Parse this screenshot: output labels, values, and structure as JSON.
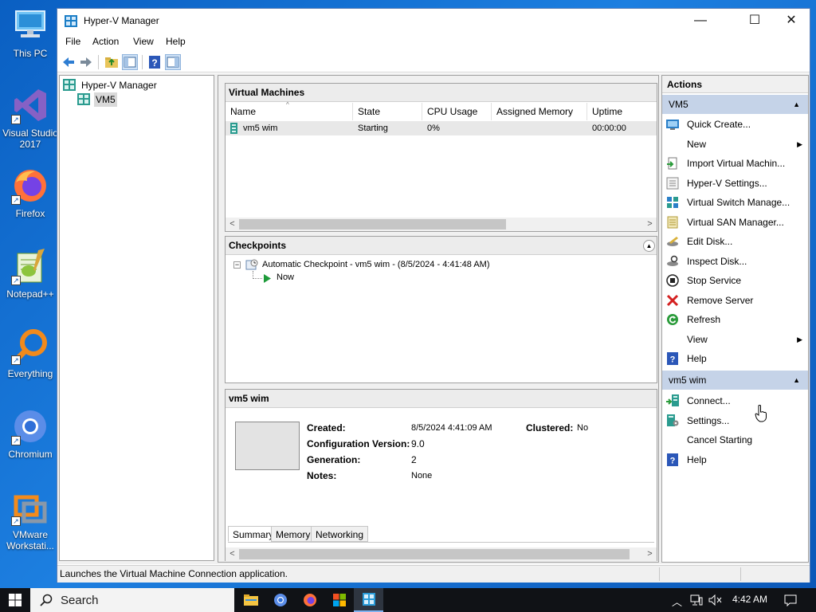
{
  "desktop": {
    "icons": [
      {
        "label": "This PC"
      },
      {
        "label": "Visual Studio 2017"
      },
      {
        "label": "Firefox"
      },
      {
        "label": "Notepad++"
      },
      {
        "label": "Everything"
      },
      {
        "label": "Chromium"
      },
      {
        "label": "VMware Workstati..."
      }
    ]
  },
  "window": {
    "title": "Hyper-V Manager",
    "controls": {
      "minimize": "—",
      "maximize": "☐",
      "close": "✕"
    }
  },
  "menu": {
    "file": "File",
    "action": "Action",
    "view": "View",
    "help": "Help"
  },
  "tree": {
    "root": "Hyper-V Manager",
    "server": "VM5"
  },
  "vm_panel": {
    "title": "Virtual Machines",
    "columns": [
      "Name",
      "State",
      "CPU Usage",
      "Assigned Memory",
      "Uptime"
    ],
    "rows": [
      {
        "name": "vm5 wim",
        "state": "Starting",
        "cpu": "0%",
        "memory": "",
        "uptime": "00:00:00"
      }
    ]
  },
  "checkpoints": {
    "title": "Checkpoints",
    "item": "Automatic Checkpoint - vm5 wim - (8/5/2024 - 4:41:48 AM)",
    "now": "Now"
  },
  "details": {
    "title": "vm5 wim",
    "created_label": "Created:",
    "created": "8/5/2024 4:41:09 AM",
    "clustered_label": "Clustered:",
    "clustered": "No",
    "config_label": "Configuration Version:",
    "config": "9.0",
    "gen_label": "Generation:",
    "gen": "2",
    "notes_label": "Notes:",
    "notes": "None",
    "tabs": [
      "Summary",
      "Memory",
      "Networking"
    ]
  },
  "actions": {
    "title": "Actions",
    "server_section": "VM5",
    "server_items": [
      {
        "label": "Quick Create...",
        "icon": "quick-create-icon"
      },
      {
        "label": "New",
        "icon": "none",
        "submenu": true
      },
      {
        "label": "Import Virtual Machin...",
        "icon": "import-icon"
      },
      {
        "label": "Hyper-V Settings...",
        "icon": "settings-icon"
      },
      {
        "label": "Virtual Switch Manage...",
        "icon": "switch-icon"
      },
      {
        "label": "Virtual SAN Manager...",
        "icon": "san-icon"
      },
      {
        "label": "Edit Disk...",
        "icon": "edit-disk-icon"
      },
      {
        "label": "Inspect Disk...",
        "icon": "inspect-disk-icon"
      },
      {
        "label": "Stop Service",
        "icon": "stop-icon"
      },
      {
        "label": "Remove Server",
        "icon": "remove-icon"
      },
      {
        "label": "Refresh",
        "icon": "refresh-icon"
      },
      {
        "label": "View",
        "icon": "none",
        "submenu": true
      },
      {
        "label": "Help",
        "icon": "help-icon"
      }
    ],
    "vm_section": "vm5 wim",
    "vm_items": [
      {
        "label": "Connect...",
        "icon": "connect-icon"
      },
      {
        "label": "Settings...",
        "icon": "vm-settings-icon"
      },
      {
        "label": "Cancel Starting",
        "icon": "none"
      },
      {
        "label": "Help",
        "icon": "help-icon"
      }
    ]
  },
  "status": {
    "text": "Launches the Virtual Machine Connection application."
  },
  "taskbar": {
    "search": "Search",
    "time": "4:42 AM"
  },
  "colors": {
    "accent": "#c5d3e8",
    "desktop": "#1d7fe0",
    "taskbar": "#101216"
  }
}
